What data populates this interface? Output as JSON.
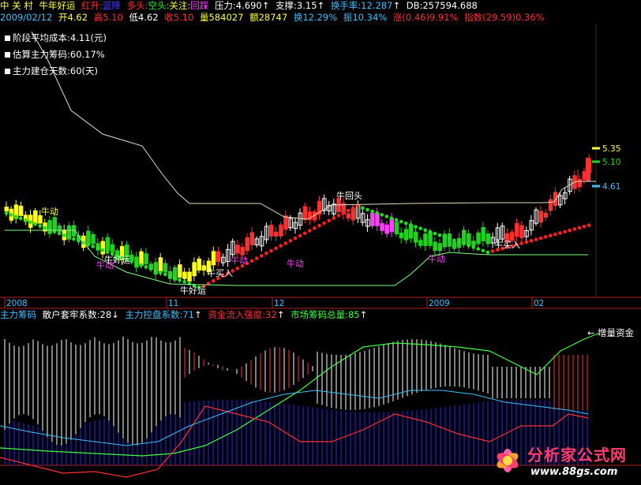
{
  "header": {
    "stock_name": "中 关 村",
    "indicator": "牛年好运",
    "red_up": "红升:",
    "red_up_val": "蓝降",
    "bull": "多头:",
    "bear": "空头:",
    "watch": "关注:",
    "watch_val": "回踩",
    "pressure": "压力:4.690",
    "support": "支撑:3.15",
    "turnover": "换手率:12.287",
    "db": "DB:257594.688"
  },
  "quote": {
    "date": "2009/02/12",
    "open": "开4.62",
    "high": "高5.10",
    "low": "低4.62",
    "close": "收5.10",
    "volume": "量584027",
    "amount": "额28747",
    "turn": "换12.29%",
    "amp": "振10.34%",
    "change": "涨(0.46)9.91%",
    "index": "指数(29.59)0.36%"
  },
  "legend": {
    "avg_cost": "阶段平均成本:4.11(元)",
    "main_chips": "估算主力筹码:60.17%",
    "build_days": "主力建仓天数:60(天)"
  },
  "price_levels": [
    "5.35",
    "5.10",
    "4.61"
  ],
  "x_axis": [
    "2008",
    "11",
    "12",
    "2009",
    "02"
  ],
  "signals": [
    "牛动",
    "牛动",
    "牛好运",
    "牛好运",
    "牛动",
    "牛买入",
    "牛动",
    "牛回头",
    "牛动",
    "牛买入"
  ],
  "subpanel": {
    "title": "主力筹码",
    "retail": "散户套牢系数:28",
    "control": "主力控盘系数:71",
    "inflow": "资金流入强度:32",
    "total": "市场筹码总量:85",
    "increment": "增量资金"
  },
  "watermark": {
    "text": "分析家公式网",
    "url": "www.88gs.com"
  },
  "colors": {
    "up": "#ff3030",
    "down": "#22d022",
    "yellow": "#ffff20",
    "blue": "#2020ff",
    "magenta": "#ff40ff",
    "cyan": "#40c0ff"
  }
}
